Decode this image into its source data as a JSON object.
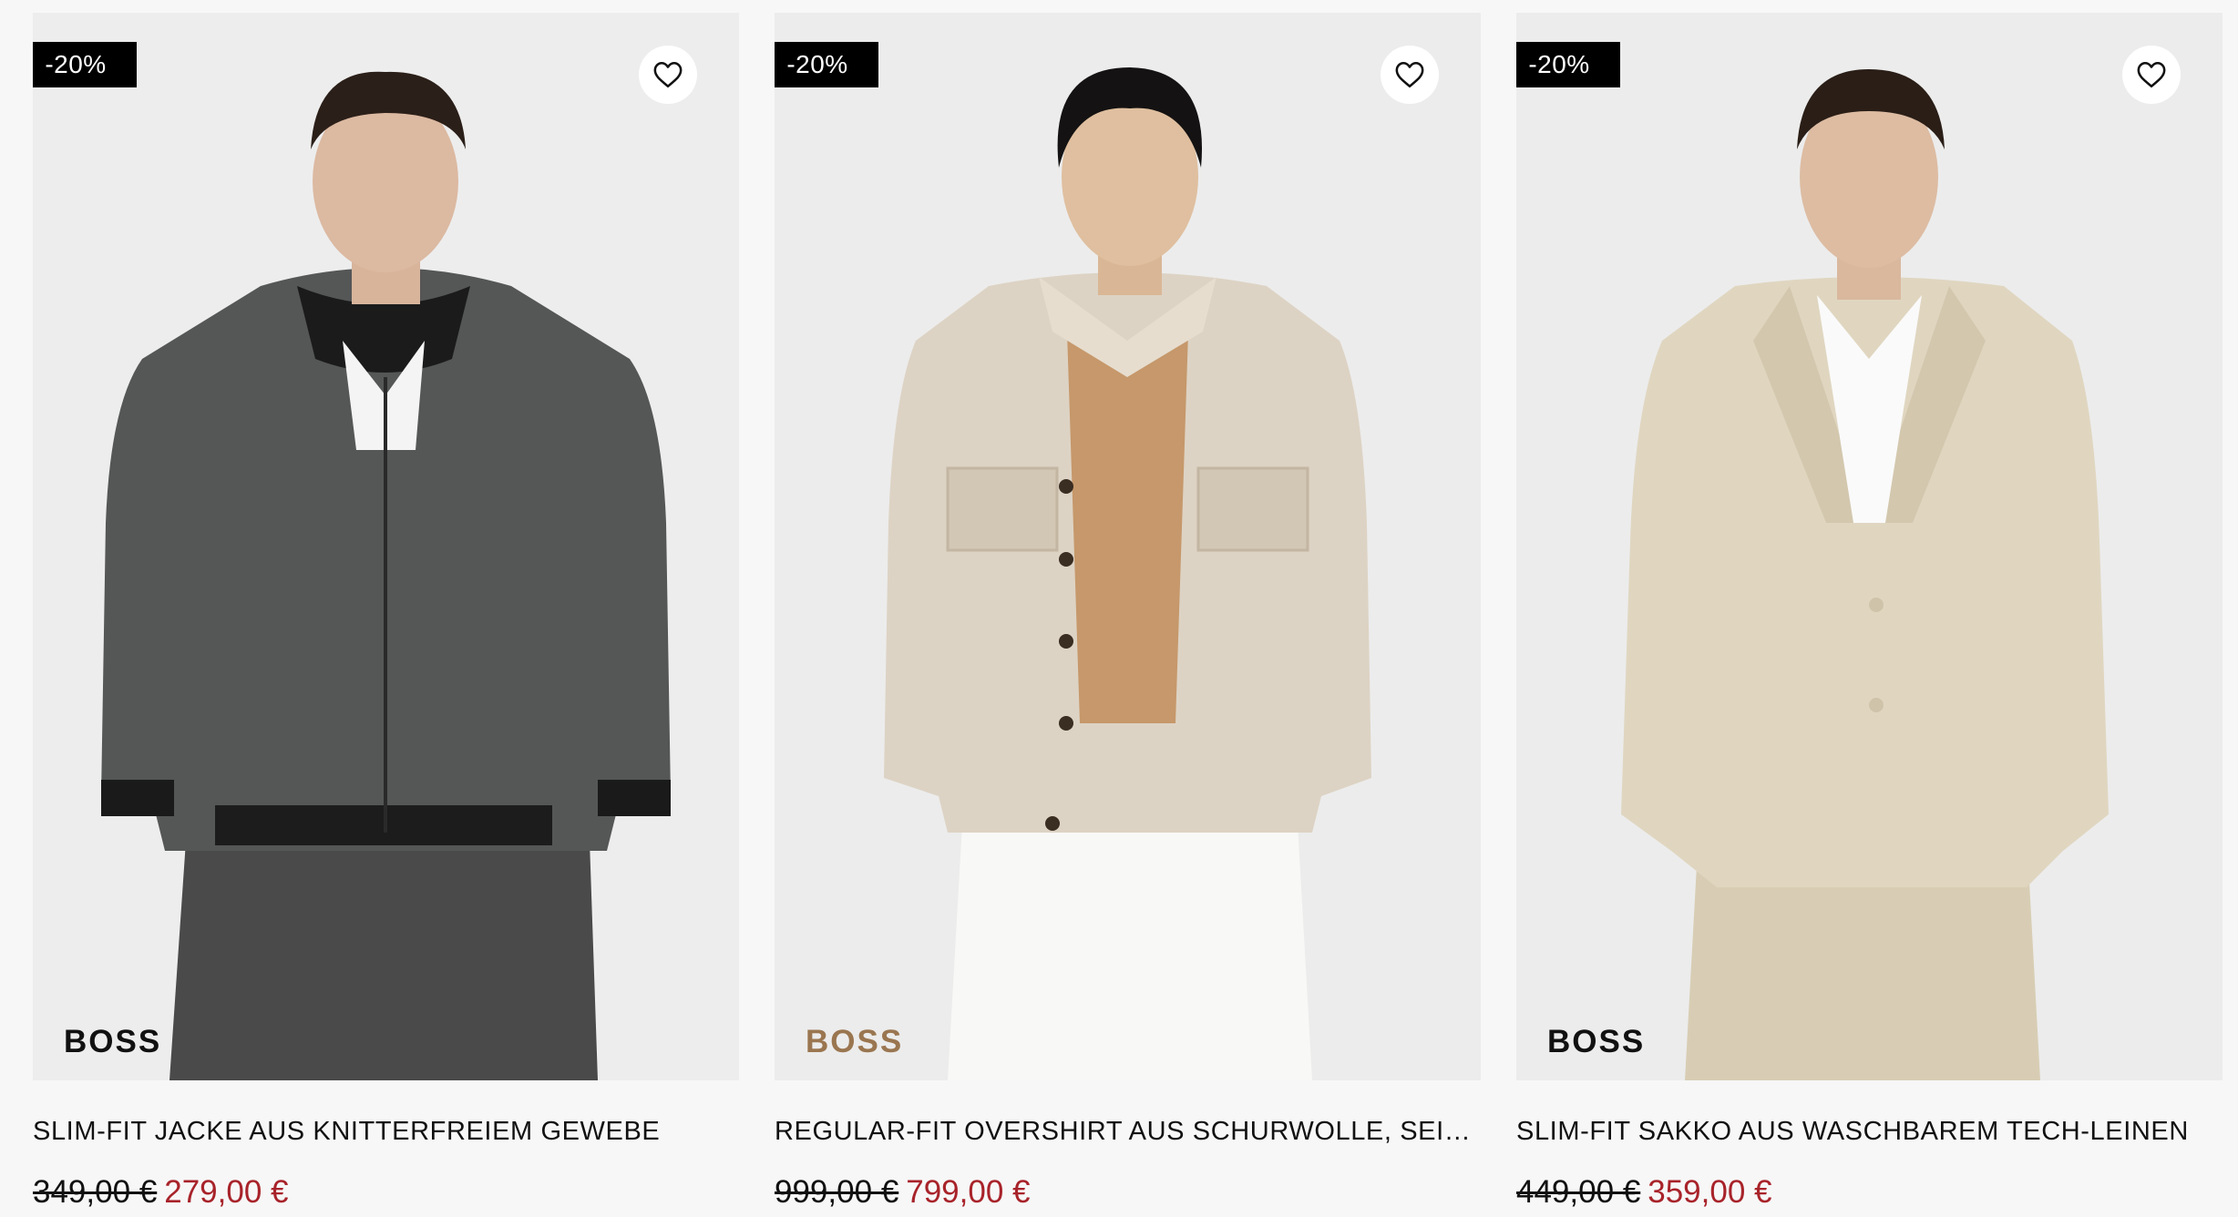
{
  "products": [
    {
      "badge": "-20%",
      "brand": "BOSS",
      "title": "SLIM-FIT JACKE AUS KNITTERFREIEM GEWEBE",
      "old_price": "349,00 €",
      "new_price": "279,00 €",
      "icon": "heart-outline-icon"
    },
    {
      "badge": "-20%",
      "brand": "BOSS",
      "title": "REGULAR-FIT OVERSHIRT AUS SCHURWOLLE, SEIDE U...",
      "old_price": "999,00 €",
      "new_price": "799,00 €",
      "icon": "heart-outline-icon"
    },
    {
      "badge": "-20%",
      "brand": "BOSS",
      "title": "SLIM-FIT SAKKO AUS WASCHBAREM TECH-LEINEN",
      "old_price": "449,00 €",
      "new_price": "359,00 €",
      "icon": "heart-outline-icon"
    }
  ],
  "colors": {
    "sale_price": "#a8232a",
    "badge_bg": "#000000",
    "brand_dark": "#111111",
    "brand_tan": "#9a7650"
  }
}
